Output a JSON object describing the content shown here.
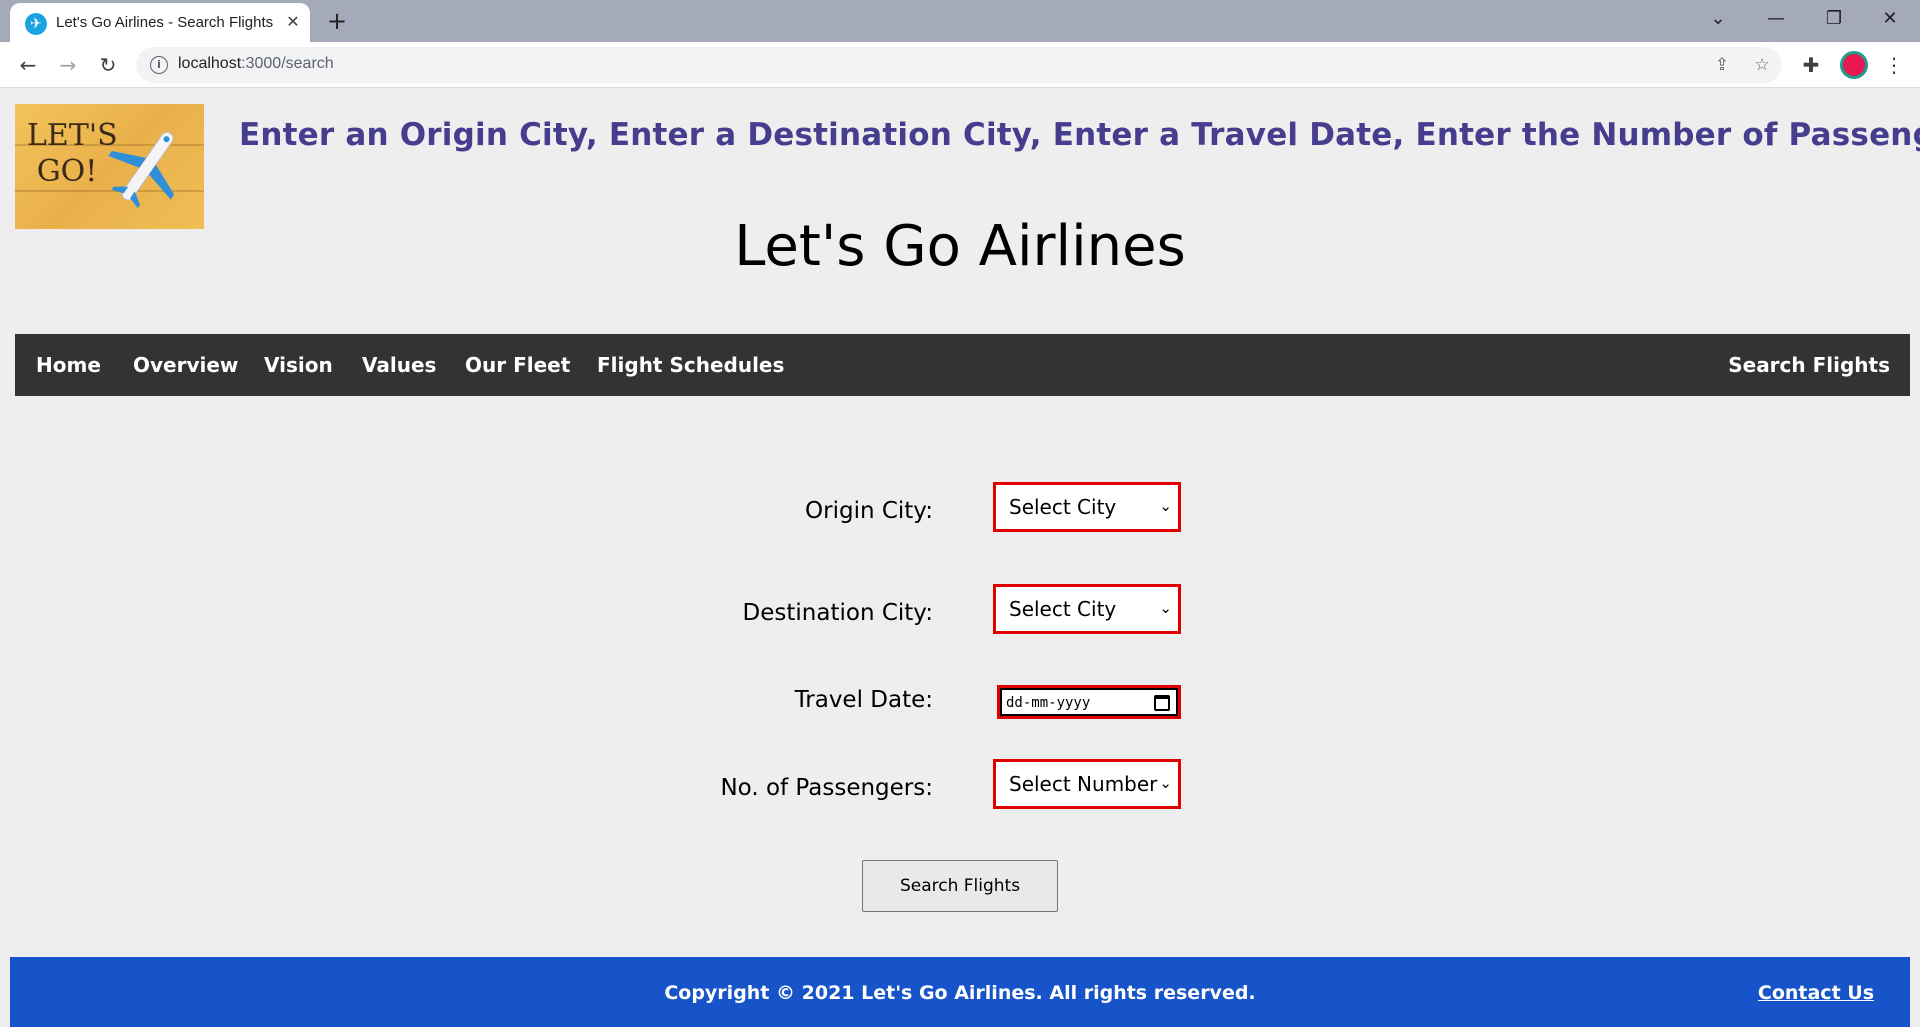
{
  "browser": {
    "tab_title": "Let's Go Airlines - Search Flights",
    "new_tab_symbol": "+",
    "url_host": "localhost",
    "url_rest": ":3000/search"
  },
  "header": {
    "logo_line1": "LET'S",
    "logo_line2": "GO!",
    "hint": "Enter an Origin City, Enter a Destination City, Enter a Travel Date, Enter the Number of Passengers",
    "site_title": "Let's Go Airlines"
  },
  "nav": {
    "items": [
      "Home",
      "Overview",
      "Vision",
      "Values",
      "Our Fleet",
      "Flight Schedules"
    ],
    "right_item": "Search Flights"
  },
  "form": {
    "origin_label": "Origin City:",
    "origin_value": "Select City",
    "destination_label": "Destination City:",
    "destination_value": "Select City",
    "date_label": "Travel Date:",
    "date_placeholder": "dd-mm-yyyy",
    "passengers_label": "No. of Passengers:",
    "passengers_value": "Select Number",
    "submit_label": "Search Flights"
  },
  "footer": {
    "copyright": "Copyright © 2021 Let's Go Airlines. All rights reserved.",
    "contact": "Contact Us"
  },
  "colors": {
    "hint_text": "#463d8e",
    "navbar_bg": "#333333",
    "footer_bg": "#1754c9",
    "field_border": "#e00000"
  }
}
